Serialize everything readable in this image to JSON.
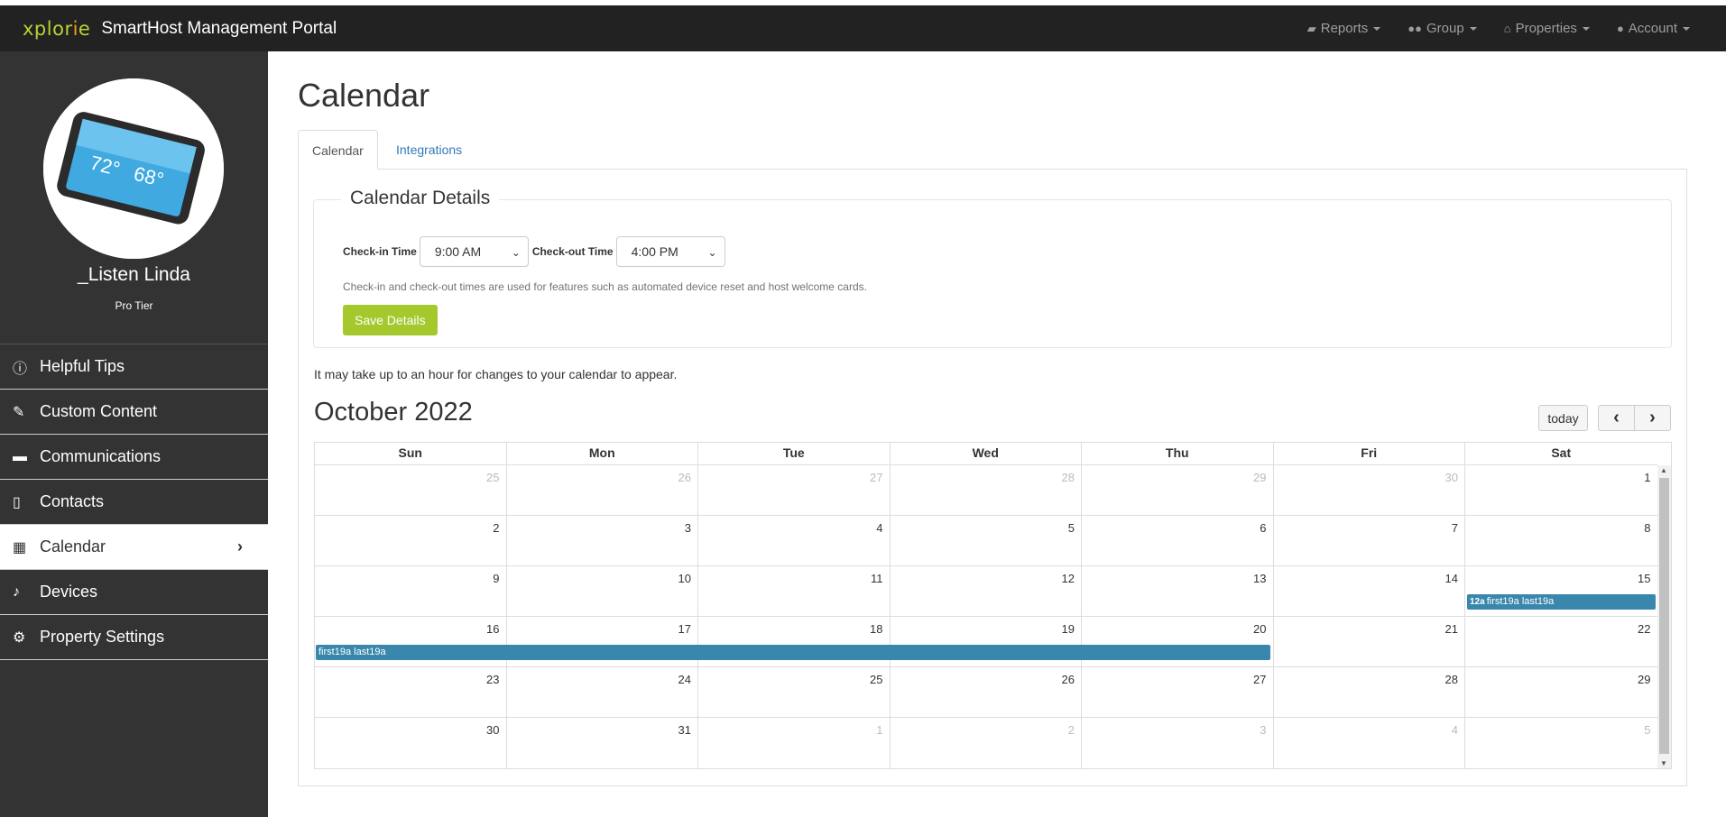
{
  "header": {
    "logo": "xplorie",
    "title": "SmartHost Management Portal",
    "nav": [
      {
        "label": "Reports",
        "icon": "folder-icon"
      },
      {
        "label": "Group",
        "icon": "group-icon"
      },
      {
        "label": "Properties",
        "icon": "home-icon"
      },
      {
        "label": "Account",
        "icon": "user-icon"
      }
    ]
  },
  "sidebar": {
    "property_name": "_Listen Linda",
    "tier": "Pro Tier",
    "device_temp": "72°",
    "device_temp2": "68°",
    "items": [
      {
        "label": "Helpful Tips",
        "icon": "info-icon"
      },
      {
        "label": "Custom Content",
        "icon": "pencil-icon"
      },
      {
        "label": "Communications",
        "icon": "chat-icon"
      },
      {
        "label": "Contacts",
        "icon": "phone-icon"
      },
      {
        "label": "Calendar",
        "icon": "calendar-icon"
      },
      {
        "label": "Devices",
        "icon": "bell-icon"
      },
      {
        "label": "Property Settings",
        "icon": "gear-icon"
      }
    ]
  },
  "main": {
    "title": "Calendar",
    "tabs": [
      "Calendar",
      "Integrations"
    ],
    "details": {
      "legend": "Calendar Details",
      "checkin_label": "Check-in Time",
      "checkin_value": "9:00 AM",
      "checkout_label": "Check-out Time",
      "checkout_value": "4:00 PM",
      "help": "Check-in and check-out times are used for features such as automated device reset and host welcome cards.",
      "save_label": "Save Details"
    },
    "notice": "It may take up to an hour for changes to your calendar to appear.",
    "calendar": {
      "month": "October 2022",
      "today_label": "today",
      "prev_label": "‹",
      "next_label": "›",
      "days": [
        "Sun",
        "Mon",
        "Tue",
        "Wed",
        "Thu",
        "Fri",
        "Sat"
      ],
      "weeks": [
        [
          "25",
          "26",
          "27",
          "28",
          "29",
          "30",
          "1"
        ],
        [
          "2",
          "3",
          "4",
          "5",
          "6",
          "7",
          "8"
        ],
        [
          "9",
          "10",
          "11",
          "12",
          "13",
          "14",
          "15"
        ],
        [
          "16",
          "17",
          "18",
          "19",
          "20",
          "21",
          "22"
        ],
        [
          "23",
          "24",
          "25",
          "26",
          "27",
          "28",
          "29"
        ],
        [
          "30",
          "31",
          "1",
          "2",
          "3",
          "4",
          "5"
        ]
      ],
      "event1_time": "12a",
      "event1_title": "first19a last19a",
      "event2_title": "first19a last19a",
      "event_color": "#3a87ad"
    }
  }
}
